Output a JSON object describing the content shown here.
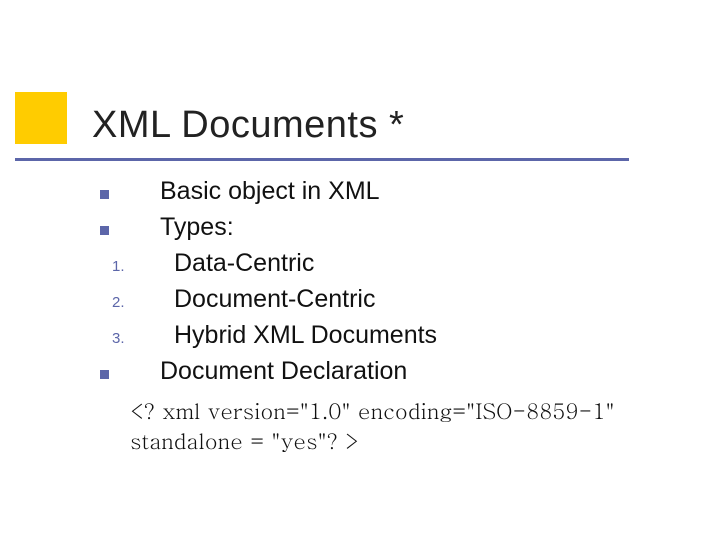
{
  "title": "XML Documents *",
  "bullets": {
    "b1": {
      "marker_type": "square",
      "text": "Basic object in XML"
    },
    "b2": {
      "marker_type": "square",
      "text": "Types:"
    },
    "b3": {
      "marker_type": "number",
      "marker": "1.",
      "text": "Data-Centric"
    },
    "b4": {
      "marker_type": "number",
      "marker": "2.",
      "text": "Document-Centric"
    },
    "b5": {
      "marker_type": "number",
      "marker": "3.",
      "text": "Hybrid XML Documents"
    },
    "b6": {
      "marker_type": "square",
      "text": "Document Declaration"
    }
  },
  "declaration": "<? xml version=\"1.0\" encoding=\"ISO-8859-1\" standalone = \"yes\"? >",
  "colors": {
    "accent_orange": "#ffcc00",
    "accent_blue": "#5c66a9"
  }
}
